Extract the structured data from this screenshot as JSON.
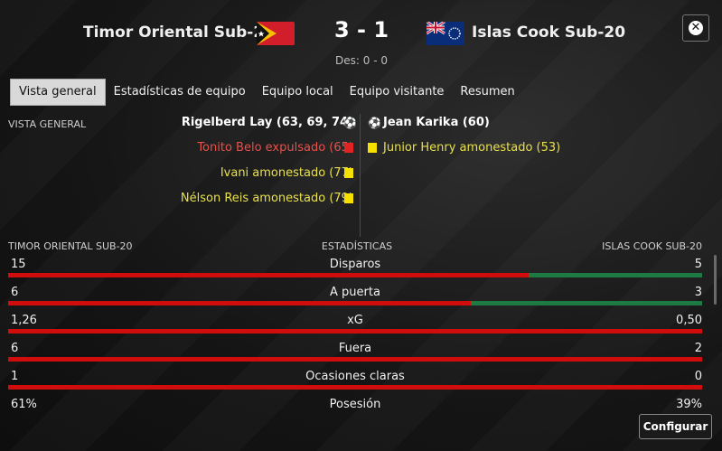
{
  "match": {
    "home_team": "Timor Oriental Sub-20",
    "away_team": "Islas Cook Sub-20",
    "score": "3 - 1",
    "halftime": "Des: 0 - 0",
    "home_flag_icon": "timor-leste-flag-icon",
    "away_flag_icon": "cook-islands-flag-icon"
  },
  "tabs": [
    {
      "label": "Vista general",
      "active": true
    },
    {
      "label": "Estadísticas de equipo",
      "active": false
    },
    {
      "label": "Equipo local",
      "active": false
    },
    {
      "label": "Equipo visitante",
      "active": false
    },
    {
      "label": "Resumen",
      "active": false
    }
  ],
  "overview": {
    "section_label": "VISTA GENERAL",
    "home_events": [
      {
        "text": "Rigelberd Lay (63, 69, 74)",
        "type": "goal",
        "color": "#ffffff"
      },
      {
        "text": "Tonito Belo expulsado (65)",
        "type": "red-card",
        "color": "#e8504a"
      },
      {
        "text": "Ivani amonestado (77)",
        "type": "yellow-card",
        "color": "#e8e04a"
      },
      {
        "text": "Nélson Reis amonestado (79)",
        "type": "yellow-card",
        "color": "#e8e04a"
      }
    ],
    "away_events": [
      {
        "text": "Jean Karika (60)",
        "type": "goal",
        "color": "#ffffff"
      },
      {
        "text": "Junior Henry amonestado (53)",
        "type": "yellow-card",
        "color": "#e8e04a"
      }
    ]
  },
  "stats": {
    "home_header": "TIMOR ORIENTAL SUB-20",
    "center_header": "ESTADÍSTICAS",
    "away_header": "ISLAS COOK SUB-20",
    "rows": [
      {
        "name": "Disparos",
        "home": "15",
        "away": "5",
        "home_share": 0.75
      },
      {
        "name": "A puerta",
        "home": "6",
        "away": "3",
        "home_share": 0.667
      },
      {
        "name": "xG",
        "home": "1,26",
        "away": "0,50",
        "home_share": 1.0
      },
      {
        "name": "Fuera",
        "home": "6",
        "away": "2",
        "home_share": 1.0
      },
      {
        "name": "Ocasiones claras",
        "home": "1",
        "away": "0",
        "home_share": 1.0
      },
      {
        "name": "Posesión",
        "home": "61%",
        "away": "39%",
        "home_share": 0.61
      }
    ]
  },
  "buttons": {
    "configure": "Configurar",
    "close_icon": "close-icon"
  },
  "colors": {
    "home_bar": "#d00c0c",
    "away_bar": "#1d7a42"
  }
}
